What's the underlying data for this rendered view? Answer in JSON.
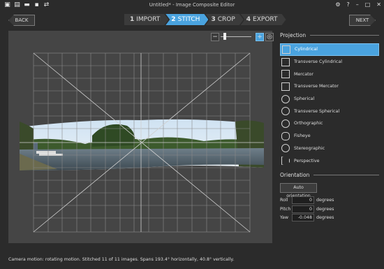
{
  "titlebar": {
    "title": "Untitled* - Image Composite Editor",
    "left_icons": [
      "new-project-icon",
      "new-panorama-icon",
      "folder-icon",
      "save-icon",
      "export-icon",
      "settings-icon"
    ],
    "right_icons": [
      "gear-icon",
      "help-icon",
      "minimize-icon",
      "maximize-icon",
      "close-icon"
    ]
  },
  "nav": {
    "back_label": "BACK",
    "next_label": "NEXT",
    "steps": [
      {
        "num": "1",
        "label": "IMPORT"
      },
      {
        "num": "2",
        "label": "STITCH"
      },
      {
        "num": "3",
        "label": "CROP"
      },
      {
        "num": "4",
        "label": "EXPORT"
      }
    ],
    "active_step": "2"
  },
  "zoom": {
    "minus": "−",
    "plus": "+",
    "level": 0.1
  },
  "projection": {
    "title": "Projection",
    "items": [
      {
        "label": "Cylindrical",
        "icon": "cylindrical-icon",
        "selected": true
      },
      {
        "label": "Transverse Cylindrical",
        "icon": "transverse-cylindrical-icon"
      },
      {
        "label": "Mercator",
        "icon": "mercator-icon"
      },
      {
        "label": "Transverse Mercator",
        "icon": "transverse-mercator-icon"
      },
      {
        "label": "Spherical",
        "icon": "spherical-icon"
      },
      {
        "label": "Transverse Spherical",
        "icon": "transverse-spherical-icon"
      },
      {
        "label": "Orthographic",
        "icon": "orthographic-icon"
      },
      {
        "label": "Fisheye",
        "icon": "fisheye-icon"
      },
      {
        "label": "Stereographic",
        "icon": "stereographic-icon"
      },
      {
        "label": "Perspective",
        "icon": "perspective-icon"
      }
    ]
  },
  "orientation": {
    "title": "Orientation",
    "auto_label": "Auto orientation",
    "rows": [
      {
        "label": "Roll",
        "value": "0",
        "unit": "degrees"
      },
      {
        "label": "Pitch",
        "value": "0",
        "unit": "degrees"
      },
      {
        "label": "Yaw",
        "value": "-0.048",
        "unit": "degrees"
      }
    ]
  },
  "status": "Camera motion: rotating motion. Stitched 11 of 11 images. Spans 193.4° horizontally, 40.8° vertically.",
  "colors": {
    "accent": "#4aa3df",
    "background": "#2b2b2b",
    "canvas": "#454545"
  }
}
